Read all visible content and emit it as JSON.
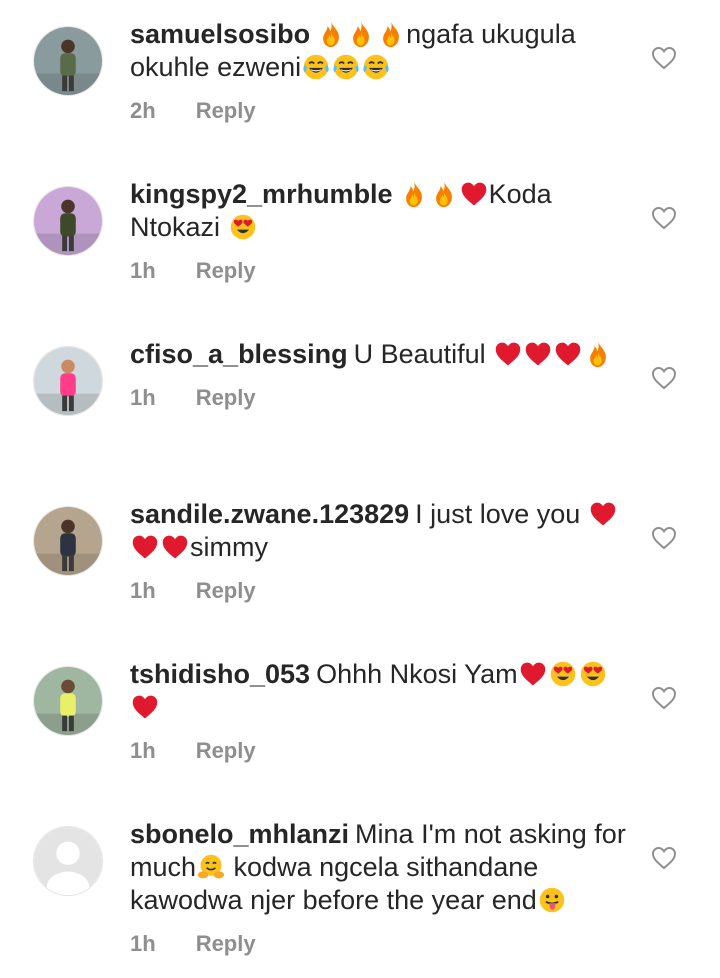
{
  "comments": [
    {
      "username": "samuelsosibo",
      "segments": [
        {
          "emoji": "fire"
        },
        {
          "emoji": "fire"
        },
        {
          "emoji": "fire"
        },
        {
          "text": "ngafa ukugula okuhle ezweni"
        },
        {
          "emoji": "joy"
        },
        {
          "emoji": "joy"
        },
        {
          "emoji": "joy"
        }
      ],
      "time": "2h",
      "reply_label": "Reply",
      "avatar": {
        "bg": "#8a9b9e",
        "figure": "#5a6b4a",
        "skin": "#4a3528"
      }
    },
    {
      "username": "kingspy2_mrhumble",
      "segments": [
        {
          "emoji": "fire"
        },
        {
          "emoji": "fire"
        },
        {
          "emoji": "heart"
        },
        {
          "text": "Koda Ntokazi "
        },
        {
          "emoji": "heart-eyes"
        }
      ],
      "time": "1h",
      "reply_label": "Reply",
      "avatar": {
        "bg": "#c9a8d8",
        "figure": "#3c4a2a",
        "skin": "#4a3528"
      }
    },
    {
      "username": "cfiso_a_blessing",
      "segments": [
        {
          "text": "U Beautiful "
        },
        {
          "emoji": "heart"
        },
        {
          "emoji": "heart"
        },
        {
          "emoji": "heart"
        },
        {
          "emoji": "fire"
        }
      ],
      "time": "1h",
      "reply_label": "Reply",
      "avatar": {
        "bg": "#cfd8dc",
        "figure": "#ff3d8a",
        "skin": "#c98a64"
      }
    },
    {
      "username": "sandile.zwane.123829",
      "segments": [
        {
          "text": "I just love you "
        },
        {
          "emoji": "heart"
        },
        {
          "emoji": "heart"
        },
        {
          "emoji": "heart"
        },
        {
          "text": "simmy"
        }
      ],
      "time": "1h",
      "reply_label": "Reply",
      "avatar": {
        "bg": "#b5a58e",
        "figure": "#2d3340",
        "skin": "#4a3528"
      }
    },
    {
      "username": "tshidisho_053",
      "segments": [
        {
          "text": "Ohhh Nkosi Yam"
        },
        {
          "emoji": "heart"
        },
        {
          "emoji": "heart-eyes"
        },
        {
          "emoji": "heart-eyes"
        },
        {
          "emoji": "heart"
        }
      ],
      "time": "1h",
      "reply_label": "Reply",
      "avatar": {
        "bg": "#9fb6a0",
        "figure": "#e8f06a",
        "skin": "#6b4a38"
      }
    },
    {
      "username": "sbonelo_mhlanzi",
      "segments": [
        {
          "text": "Mina I'm not asking for much"
        },
        {
          "emoji": "hugging"
        },
        {
          "text": " kodwa ngcela sithandane kawodwa njer before the year end"
        },
        {
          "emoji": "tongue"
        }
      ],
      "time": "1h",
      "reply_label": "Reply",
      "avatar": {
        "bg": "#e4e4e4",
        "figure": "#ffffff",
        "skin": "#ffffff",
        "placeholder": true
      }
    }
  ],
  "colors": {
    "text": "#262626",
    "meta": "#8e8e8e",
    "heart": "#e0192f",
    "fire": "#f77f00"
  },
  "icons": {
    "like": "heart-outline-icon"
  }
}
